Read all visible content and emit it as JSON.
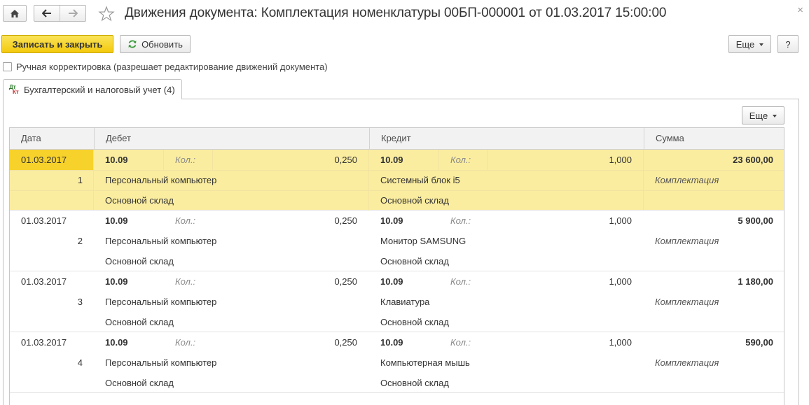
{
  "window": {
    "title": "Движения документа: Комплектация номенклатуры 00БП-000001 от 01.03.2017 15:00:00",
    "close_glyph": "×"
  },
  "toolbar": {
    "save_close": "Записать и закрыть",
    "refresh": "Обновить",
    "more": "Еще",
    "help": "?"
  },
  "manual_edit": {
    "label": "Ручная корректировка (разрешает редактирование движений документа)",
    "checked": false
  },
  "tab": {
    "label": "Бухгалтерский и налоговый учет (4)",
    "icon_top": "Дт",
    "icon_bottom": "Кт"
  },
  "grid_toolbar": {
    "more": "Еще"
  },
  "grid": {
    "columns": {
      "date": "Дата",
      "debit": "Дебет",
      "credit": "Кредит",
      "sum": "Сумма"
    },
    "qty_label": "Кол.:",
    "rows": [
      {
        "date": "01.03.2017",
        "num": "1",
        "debit_account": "10.09",
        "debit_qty": "0,250",
        "debit_item": "Персональный компьютер",
        "debit_warehouse": "Основной склад",
        "credit_account": "10.09",
        "credit_qty": "1,000",
        "credit_item": "Системный блок i5",
        "credit_warehouse": "Основной склад",
        "sum": "23 600,00",
        "content": "Комплектация"
      },
      {
        "date": "01.03.2017",
        "num": "2",
        "debit_account": "10.09",
        "debit_qty": "0,250",
        "debit_item": "Персональный компьютер",
        "debit_warehouse": "Основной склад",
        "credit_account": "10.09",
        "credit_qty": "1,000",
        "credit_item": "Монитор SAMSUNG",
        "credit_warehouse": "Основной склад",
        "sum": "5 900,00",
        "content": "Комплектация"
      },
      {
        "date": "01.03.2017",
        "num": "3",
        "debit_account": "10.09",
        "debit_qty": "0,250",
        "debit_item": "Персональный компьютер",
        "debit_warehouse": "Основной склад",
        "credit_account": "10.09",
        "credit_qty": "1,000",
        "credit_item": "Клавиатура",
        "credit_warehouse": "Основной склад",
        "sum": "1 180,00",
        "content": "Комплектация"
      },
      {
        "date": "01.03.2017",
        "num": "4",
        "debit_account": "10.09",
        "debit_qty": "0,250",
        "debit_item": "Персональный компьютер",
        "debit_warehouse": "Основной склад",
        "credit_account": "10.09",
        "credit_qty": "1,000",
        "credit_item": "Компьютерная мышь",
        "credit_warehouse": "Основной склад",
        "sum": "590,00",
        "content": "Комплектация"
      }
    ]
  },
  "colors": {
    "accent_yellow": "#f3c90c",
    "selected_row": "#fbeda0",
    "selected_cell": "#f7d22b"
  }
}
